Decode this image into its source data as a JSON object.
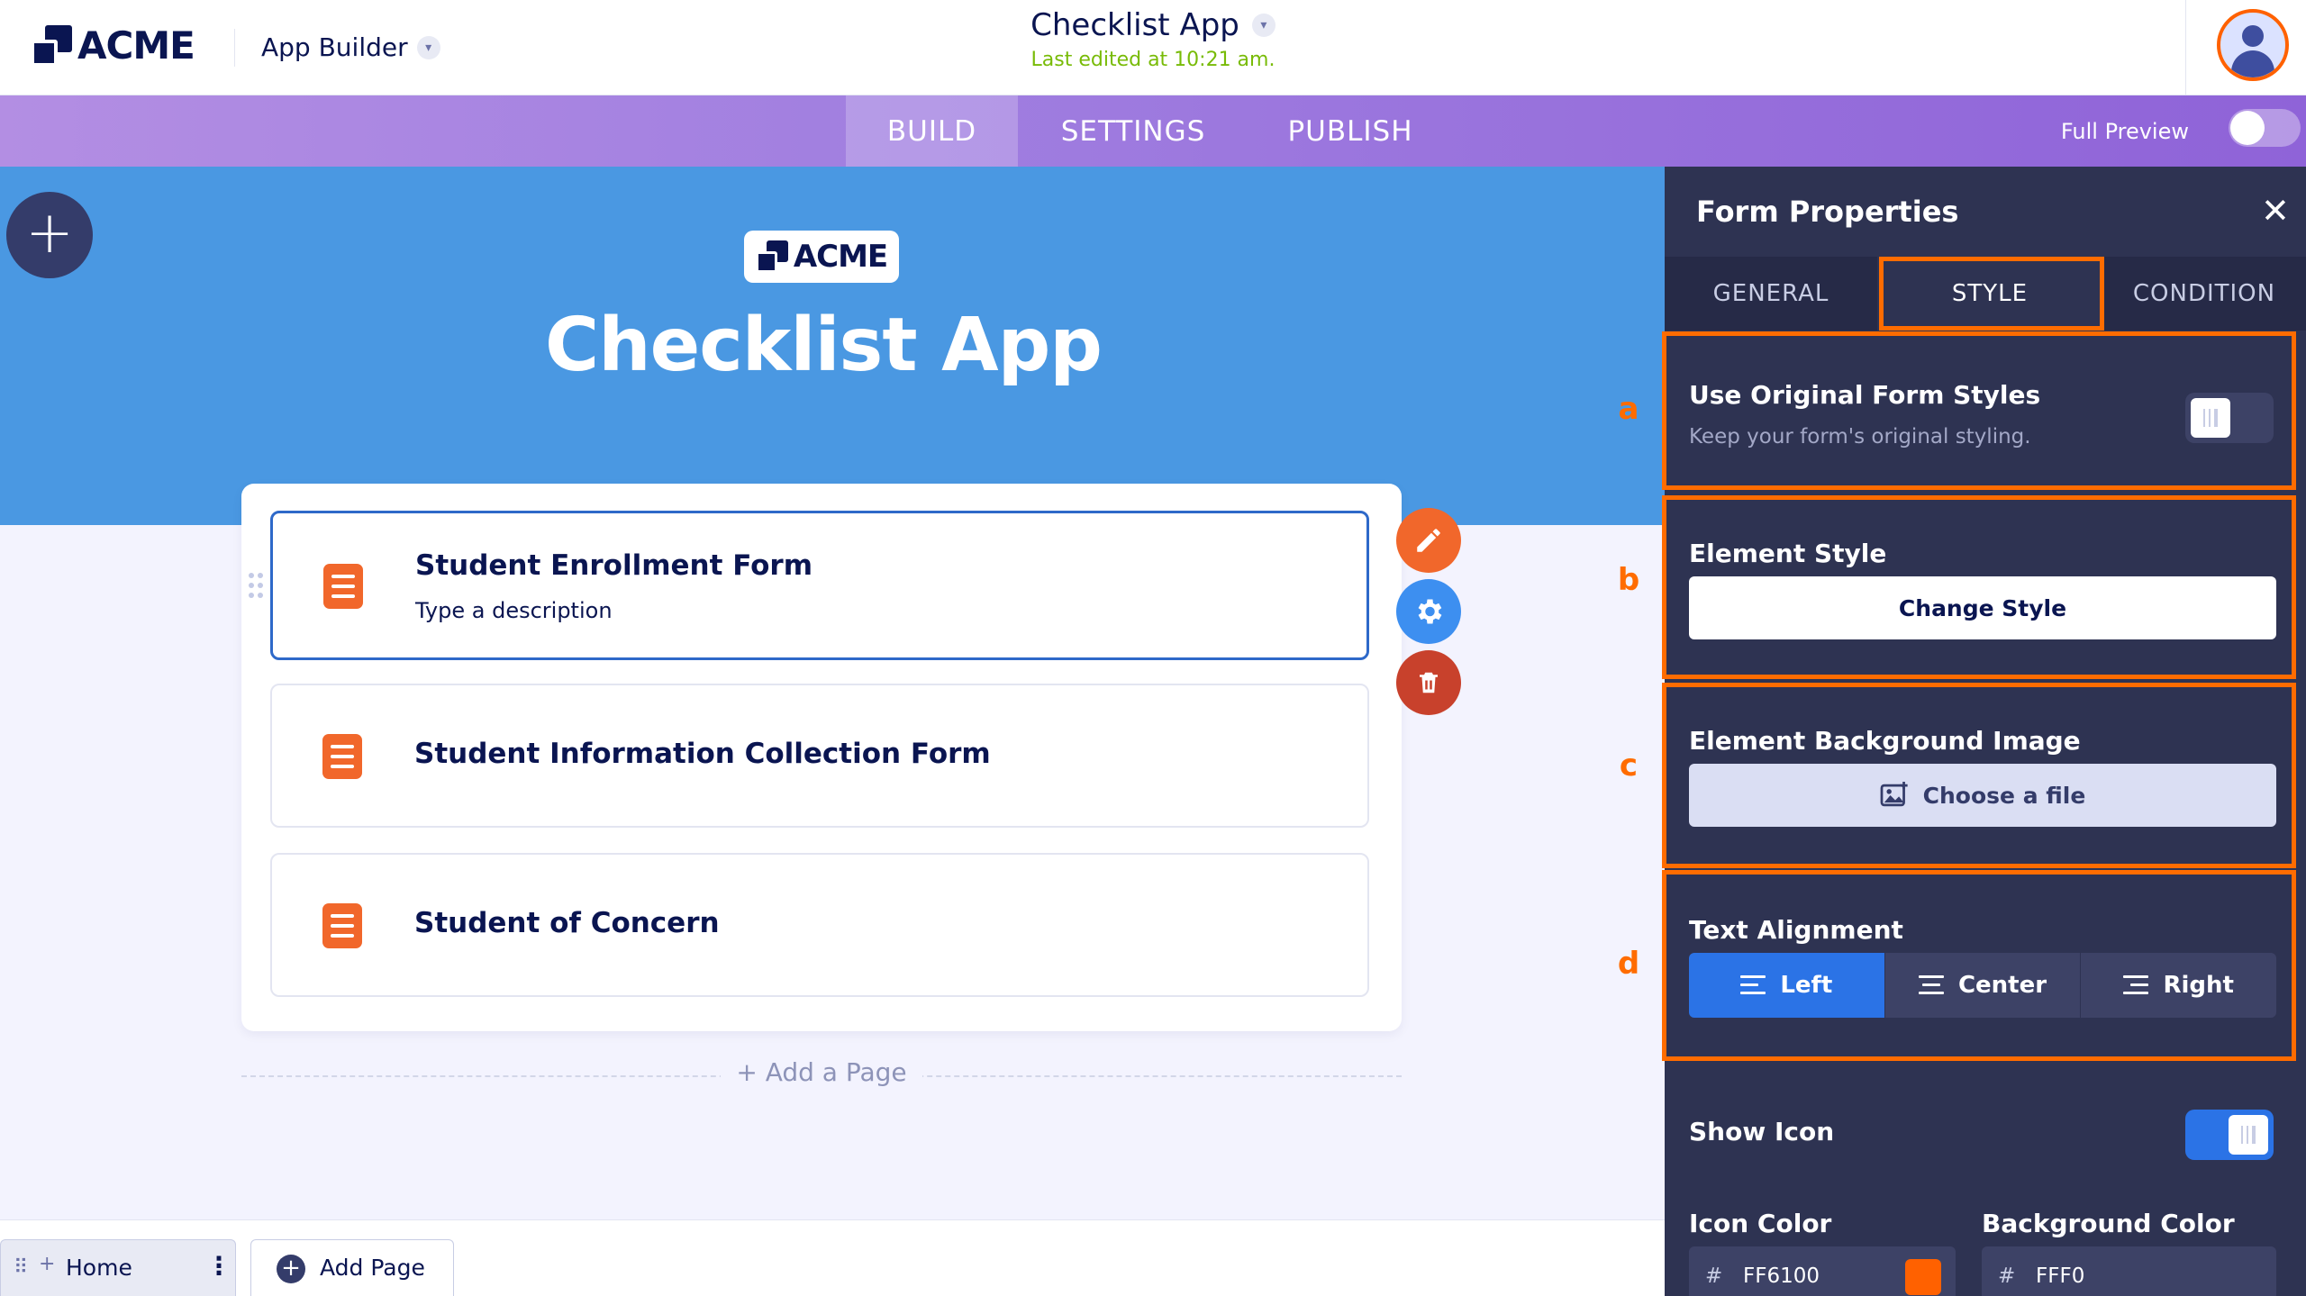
{
  "header": {
    "brand": "ACME",
    "app_builder_label": "App Builder",
    "app_title": "Checklist App",
    "last_edited": "Last edited at 10:21 am."
  },
  "nav": {
    "tabs": [
      {
        "label": "BUILD",
        "active": true
      },
      {
        "label": "SETTINGS",
        "active": false
      },
      {
        "label": "PUBLISH",
        "active": false
      }
    ],
    "full_preview_label": "Full Preview",
    "full_preview_on": false
  },
  "canvas": {
    "logo_text": "ACME",
    "title": "Checklist App",
    "items": [
      {
        "title": "Student Enrollment Form",
        "description": "Type a description",
        "selected": true
      },
      {
        "title": "Student Information Collection Form",
        "description": "",
        "selected": false
      },
      {
        "title": "Student of Concern",
        "description": "",
        "selected": false
      }
    ],
    "add_page_label": "+ Add a Page",
    "item_actions": [
      "pencil-icon",
      "gear-icon",
      "trash-icon"
    ]
  },
  "bottom": {
    "home_label": "Home",
    "add_page_label": "Add Page"
  },
  "panel": {
    "title": "Form Properties",
    "tabs": [
      {
        "label": "GENERAL",
        "active": false
      },
      {
        "label": "STYLE",
        "active": true
      },
      {
        "label": "CONDITION",
        "active": false
      }
    ],
    "sections": {
      "original_styles": {
        "title": "Use Original Form Styles",
        "subtitle": "Keep your form's original styling.",
        "enabled": false
      },
      "element_style": {
        "title": "Element Style",
        "button": "Change Style"
      },
      "background_image": {
        "title": "Element Background Image",
        "button": "Choose a file"
      },
      "text_alignment": {
        "title": "Text Alignment",
        "options": [
          "Left",
          "Center",
          "Right"
        ],
        "selected": "Left"
      },
      "show_icon": {
        "title": "Show Icon",
        "enabled": true
      },
      "icon_color": {
        "label": "Icon Color",
        "value": "FF6100",
        "swatch": "#FF6100"
      },
      "background_color": {
        "label": "Background Color",
        "value": "FFF0"
      }
    },
    "annotations": [
      "a",
      "b",
      "c",
      "d"
    ]
  },
  "colors": {
    "accent_orange": "#FF6100",
    "nav_purple": "#9B72DE",
    "hero_blue": "#4A98E2",
    "panel_dark": "#2E3352",
    "active_blue": "#2B73E6"
  }
}
